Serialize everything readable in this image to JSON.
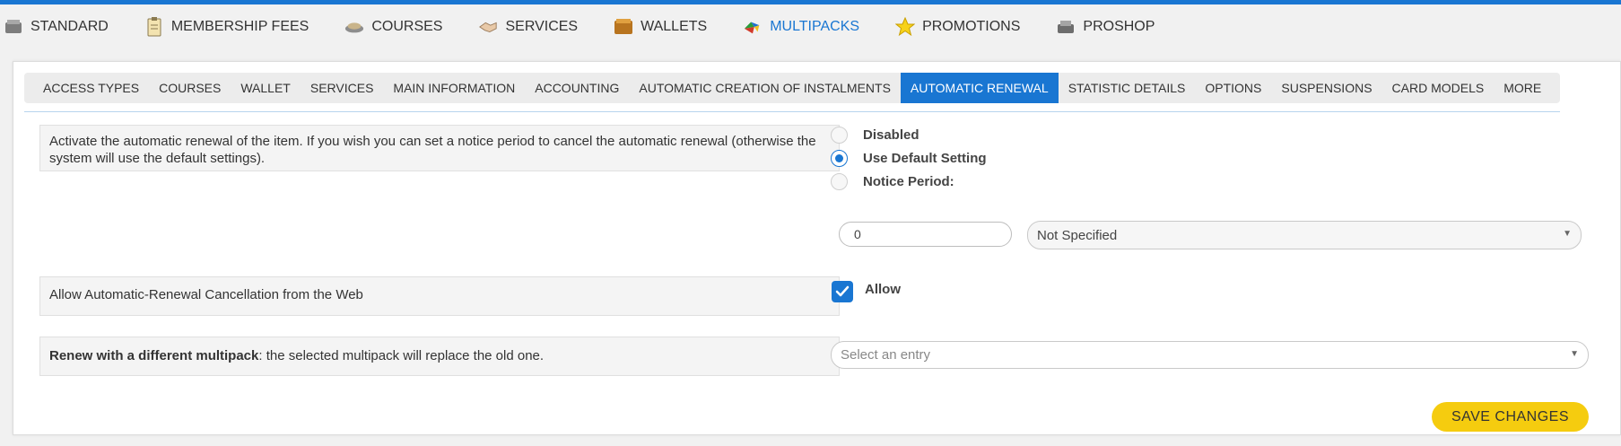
{
  "main_nav": [
    {
      "label": "STANDARD",
      "icon": "standard-icon"
    },
    {
      "label": "MEMBERSHIP FEES",
      "icon": "membership-fees-icon"
    },
    {
      "label": "COURSES",
      "icon": "courses-icon"
    },
    {
      "label": "SERVICES",
      "icon": "services-icon"
    },
    {
      "label": "WALLETS",
      "icon": "wallets-icon"
    },
    {
      "label": "MULTIPACKS",
      "icon": "multipacks-icon",
      "active": true
    },
    {
      "label": "PROMOTIONS",
      "icon": "star-icon"
    },
    {
      "label": "PROSHOP",
      "icon": "proshop-icon"
    }
  ],
  "sub_tabs": [
    {
      "label": "ACCESS TYPES"
    },
    {
      "label": "COURSES"
    },
    {
      "label": "WALLET"
    },
    {
      "label": "SERVICES"
    },
    {
      "label": "MAIN INFORMATION"
    },
    {
      "label": "ACCOUNTING"
    },
    {
      "label": "AUTOMATIC CREATION OF INSTALMENTS"
    },
    {
      "label": "AUTOMATIC RENEWAL",
      "active": true
    },
    {
      "label": "STATISTIC DETAILS"
    },
    {
      "label": "OPTIONS"
    },
    {
      "label": "SUSPENSIONS"
    },
    {
      "label": "CARD MODELS"
    },
    {
      "label": "MORE"
    }
  ],
  "renewal": {
    "description": "Activate the automatic renewal of the item. If you wish you can set a notice period to cancel the automatic renewal (otherwise the system will use the default settings).",
    "options": [
      {
        "label": "Disabled",
        "checked": false
      },
      {
        "label": "Use Default Setting",
        "checked": true
      },
      {
        "label": "Notice Period:",
        "checked": false
      }
    ],
    "notice_value": "0",
    "notice_unit": "Not Specified"
  },
  "web_cancellation": {
    "description": "Allow Automatic-Renewal Cancellation from the Web",
    "checkbox_label": "Allow",
    "checked": true
  },
  "different_multipack": {
    "description_bold": "Renew with a different multipack",
    "description_rest": ": the selected multipack will replace the old one.",
    "placeholder": "Select an entry"
  },
  "save_label": "SAVE CHANGES",
  "colors": {
    "accent": "#1976d2",
    "save_button": "#f5cc0f"
  }
}
